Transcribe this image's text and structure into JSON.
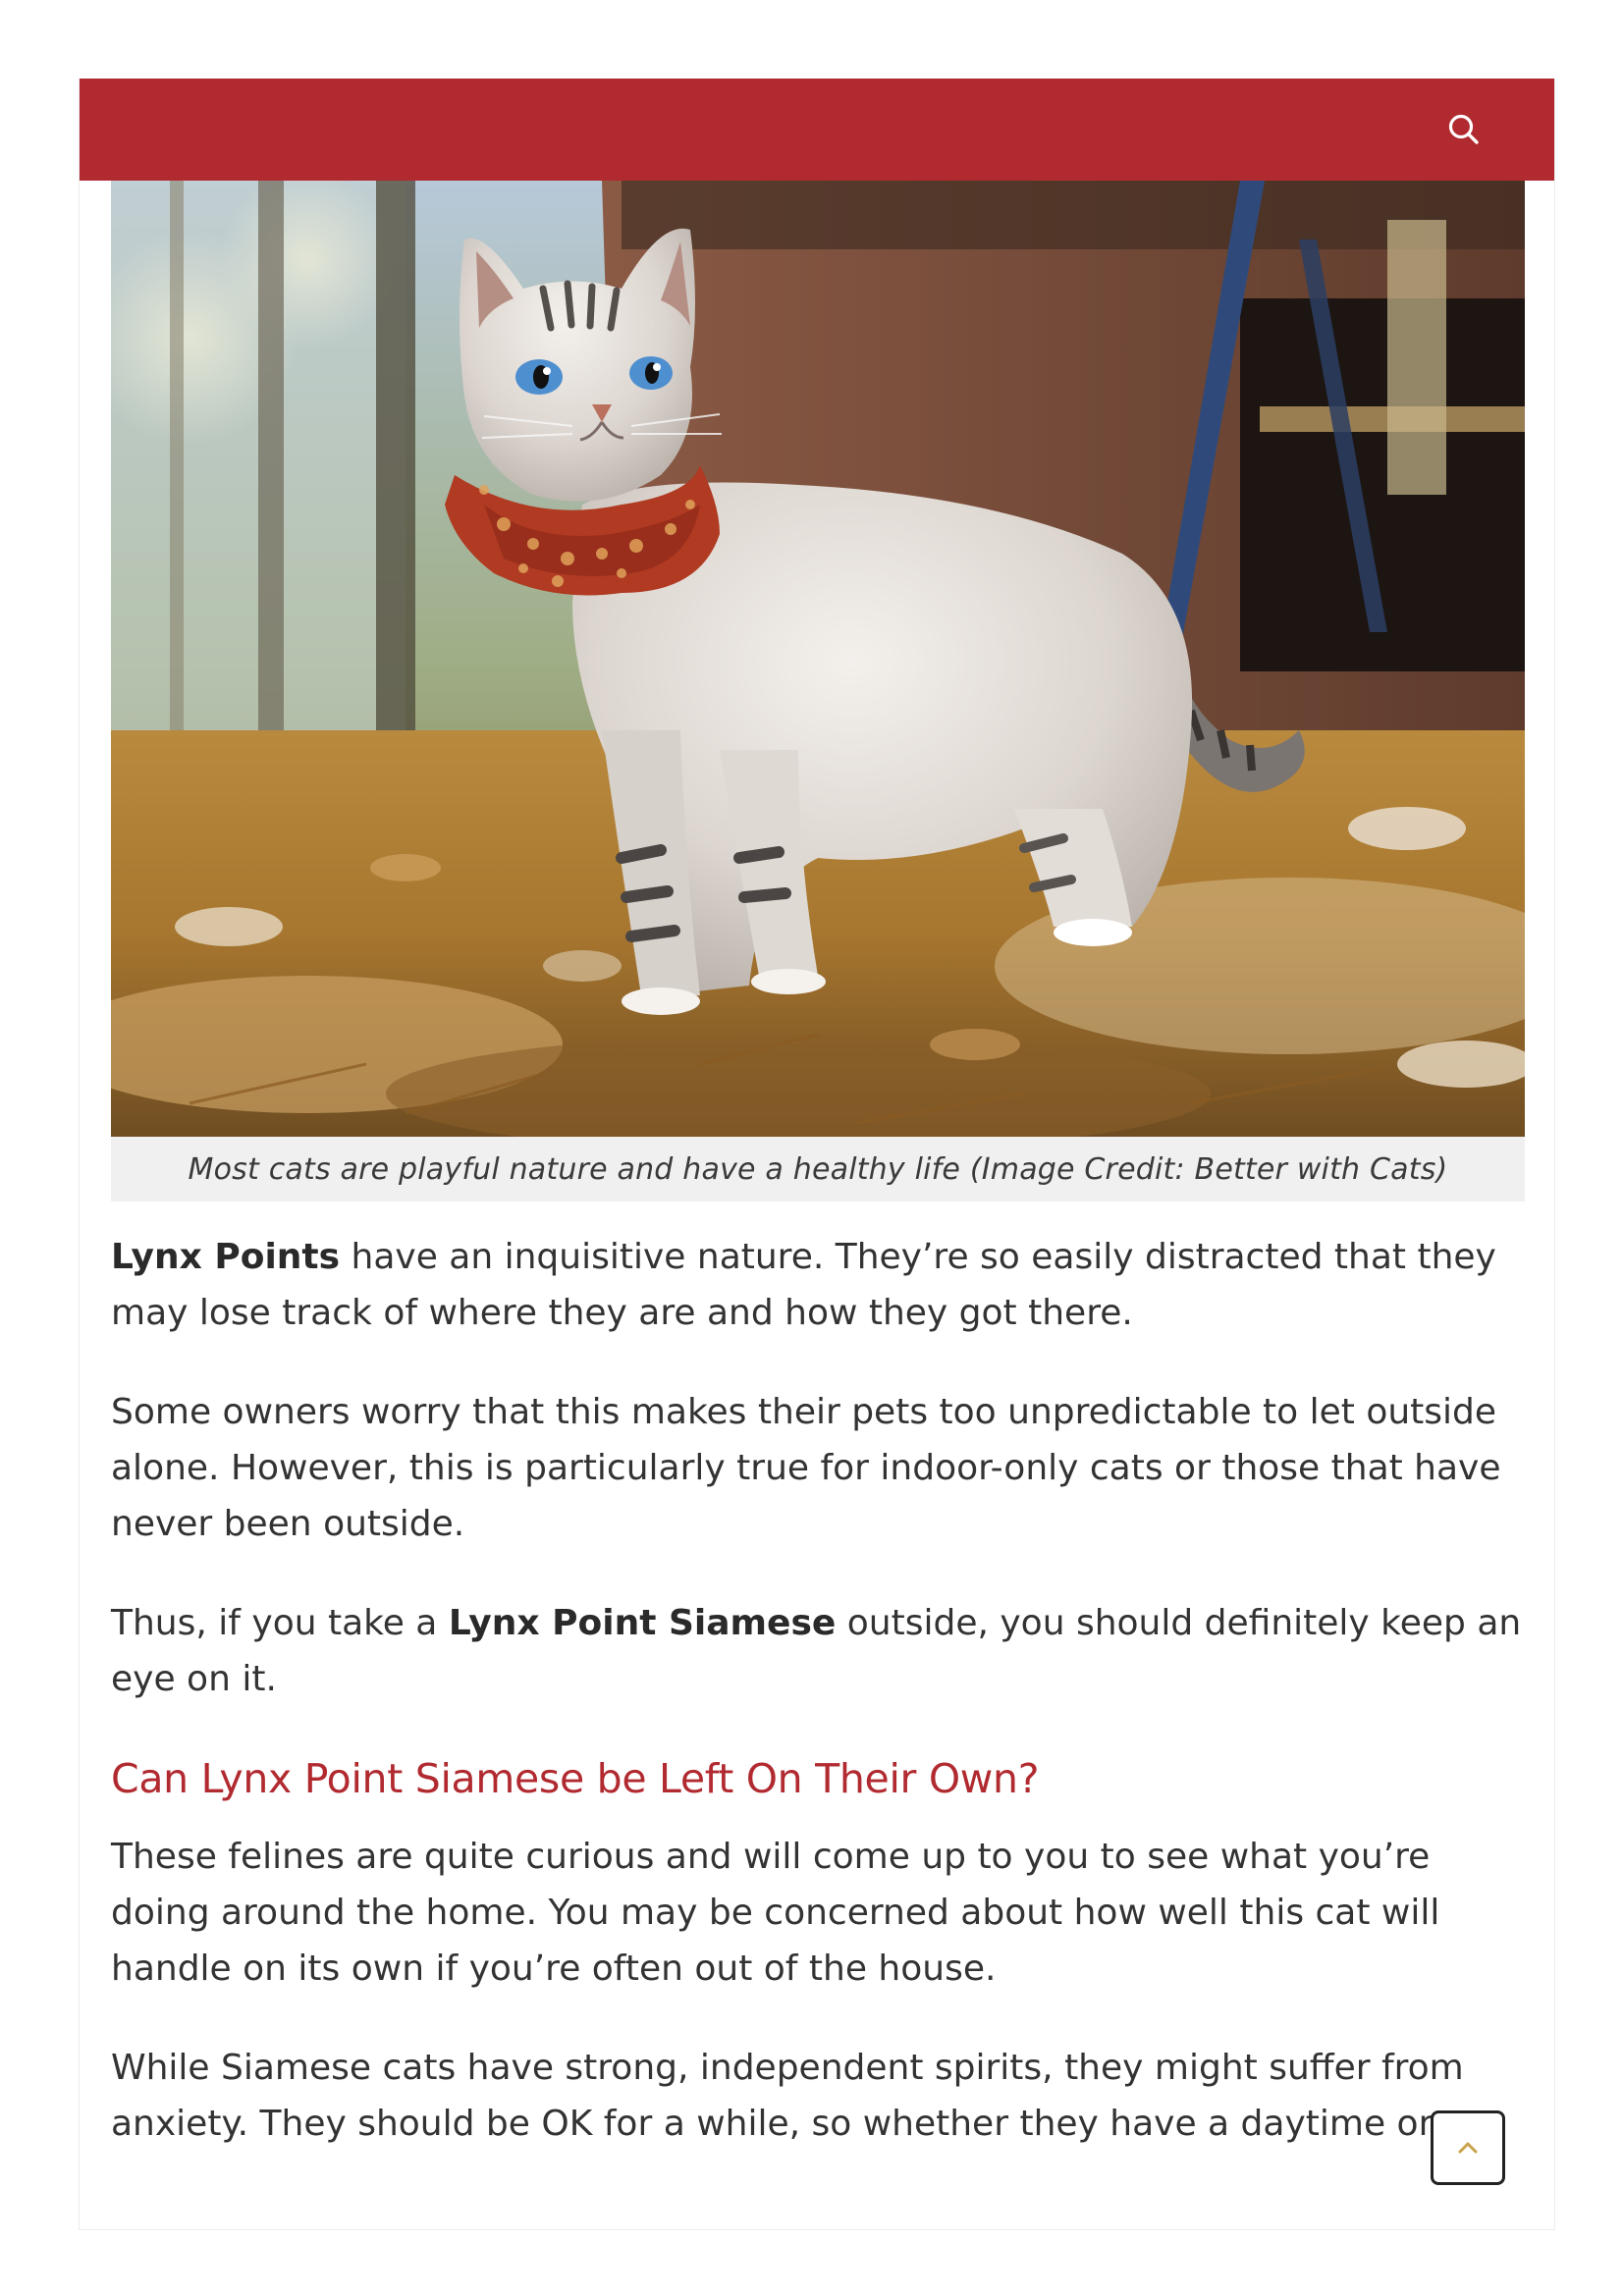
{
  "header": {
    "search_icon": "search-icon",
    "bar_color": "#b12a30"
  },
  "figure": {
    "image_alt": "Lynx point Siamese cat wearing a red patterned bandana standing on autumn leaves",
    "caption": "Most cats are playful nature and have a healthy life (Image Credit: Better with Cats)"
  },
  "article": {
    "p1": {
      "bold": "Lynx Points",
      "text": " have an inquisitive nature. They’re so easily distracted that they may lose track of where they are and how they got there."
    },
    "p2": "Some owners worry that this makes their pets too unpredictable to let outside alone. However, this is particularly true for indoor-only cats or those that have never been outside.",
    "p3": {
      "before": "Thus, if you take a ",
      "bold": "Lynx Point Siamese",
      "after": " outside, you should definitely keep an eye on it."
    },
    "heading": "Can Lynx Point Siamese be Left On Their Own?",
    "p4": "These felines are quite curious and will come up to you to see what you’re doing around the home. You may be concerned about how well this cat will handle on its own if you’re often out of the house.",
    "p5": "While Siamese cats have strong, independent spirits, they might suffer from anxiety. They should be OK for a while, so whether they have a daytime or"
  },
  "scroll_top": {
    "icon": "chevron-up-icon",
    "accent": "#c9a24a"
  },
  "colors": {
    "accent": "#b12a30",
    "caption_bg": "#f0f0f0",
    "text": "#333333"
  }
}
